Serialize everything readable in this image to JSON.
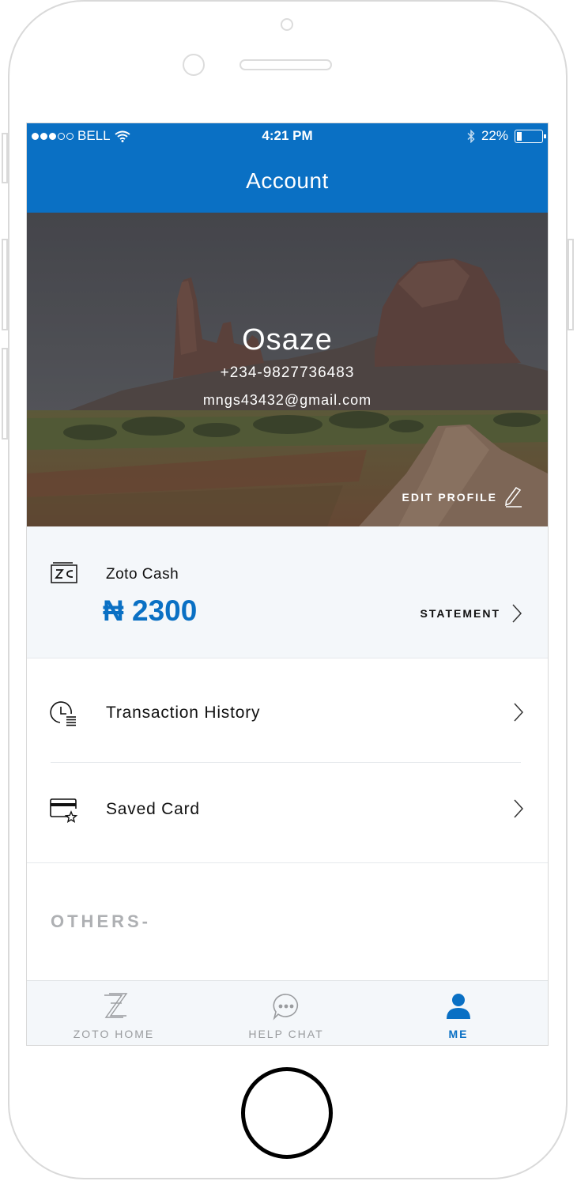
{
  "status_bar": {
    "carrier": "BELL",
    "time": "4:21 PM",
    "battery": "22%",
    "signal_icon": "signal-dots-icon",
    "wifi_icon": "wifi-icon",
    "bluetooth_icon": "bluetooth-icon",
    "battery_icon": "battery-icon"
  },
  "nav": {
    "title": "Account"
  },
  "profile": {
    "name": "Osaze",
    "phone": "+234-9827736483",
    "email": "mngs43432@gmail.com",
    "edit_label": "EDIT PROFILE",
    "edit_icon": "pencil-icon"
  },
  "wallet": {
    "label": "Zoto Cash",
    "amount": "₦ 2300",
    "statement_label": "STATEMENT",
    "icon": "wallet-icon"
  },
  "menu": {
    "items": [
      {
        "label": "Transaction History",
        "icon": "clock-list-icon"
      },
      {
        "label": "Saved Card",
        "icon": "card-star-icon"
      }
    ]
  },
  "section": {
    "others_label": "OTHERS-"
  },
  "tabbar": {
    "tabs": [
      {
        "label": "ZOTO HOME",
        "icon": "zoto-logo-icon",
        "active": false
      },
      {
        "label": "HELP CHAT",
        "icon": "chat-bubble-icon",
        "active": false
      },
      {
        "label": "ME",
        "icon": "person-icon",
        "active": true
      }
    ]
  },
  "colors": {
    "accent": "#0a70c4",
    "muted": "#9a9c9f",
    "panel": "#f4f7fa"
  }
}
